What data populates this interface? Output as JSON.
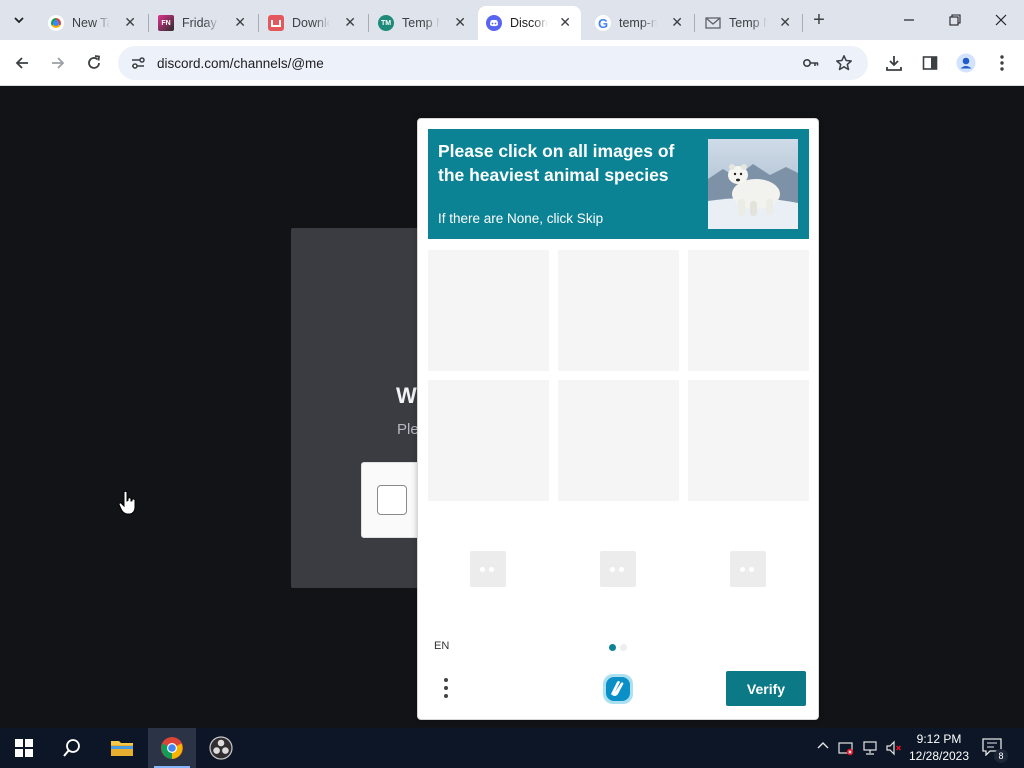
{
  "browser": {
    "tabs": [
      {
        "title": "New Tab",
        "favicon": "chrome-icon",
        "active": false
      },
      {
        "title": "Friday Night Funkin",
        "favicon": "fnf-icon",
        "active": false
      },
      {
        "title": "Download",
        "favicon": "download-site-icon",
        "active": false
      },
      {
        "title": "Temp Mail",
        "favicon": "temp-mail-icon",
        "active": false
      },
      {
        "title": "Discord",
        "favicon": "discord-icon",
        "active": true
      },
      {
        "title": "temp-mail",
        "favicon": "google-icon",
        "active": false
      },
      {
        "title": "Temp Mail",
        "favicon": "mail-icon",
        "active": false
      }
    ],
    "address_bar": {
      "url": "discord.com/channels/@me"
    }
  },
  "discord": {
    "heading": "W",
    "subtext": "Ple"
  },
  "hcaptcha": {
    "prompt": "Please click on all images of the heaviest animal species",
    "subprompt": "If there are None, click Skip",
    "sample_image": "polar-bear",
    "language": "EN",
    "verify_label": "Verify",
    "accent_color": "#0b8394",
    "pages": [
      {
        "active": true
      },
      {
        "active": false
      }
    ]
  },
  "taskbar": {
    "apps": [
      "windows-start",
      "search",
      "file-explorer",
      "chrome",
      "obs-studio"
    ],
    "active_app": "chrome",
    "time": "9:12 PM",
    "date": "12/28/2023",
    "notification_count": "8"
  }
}
